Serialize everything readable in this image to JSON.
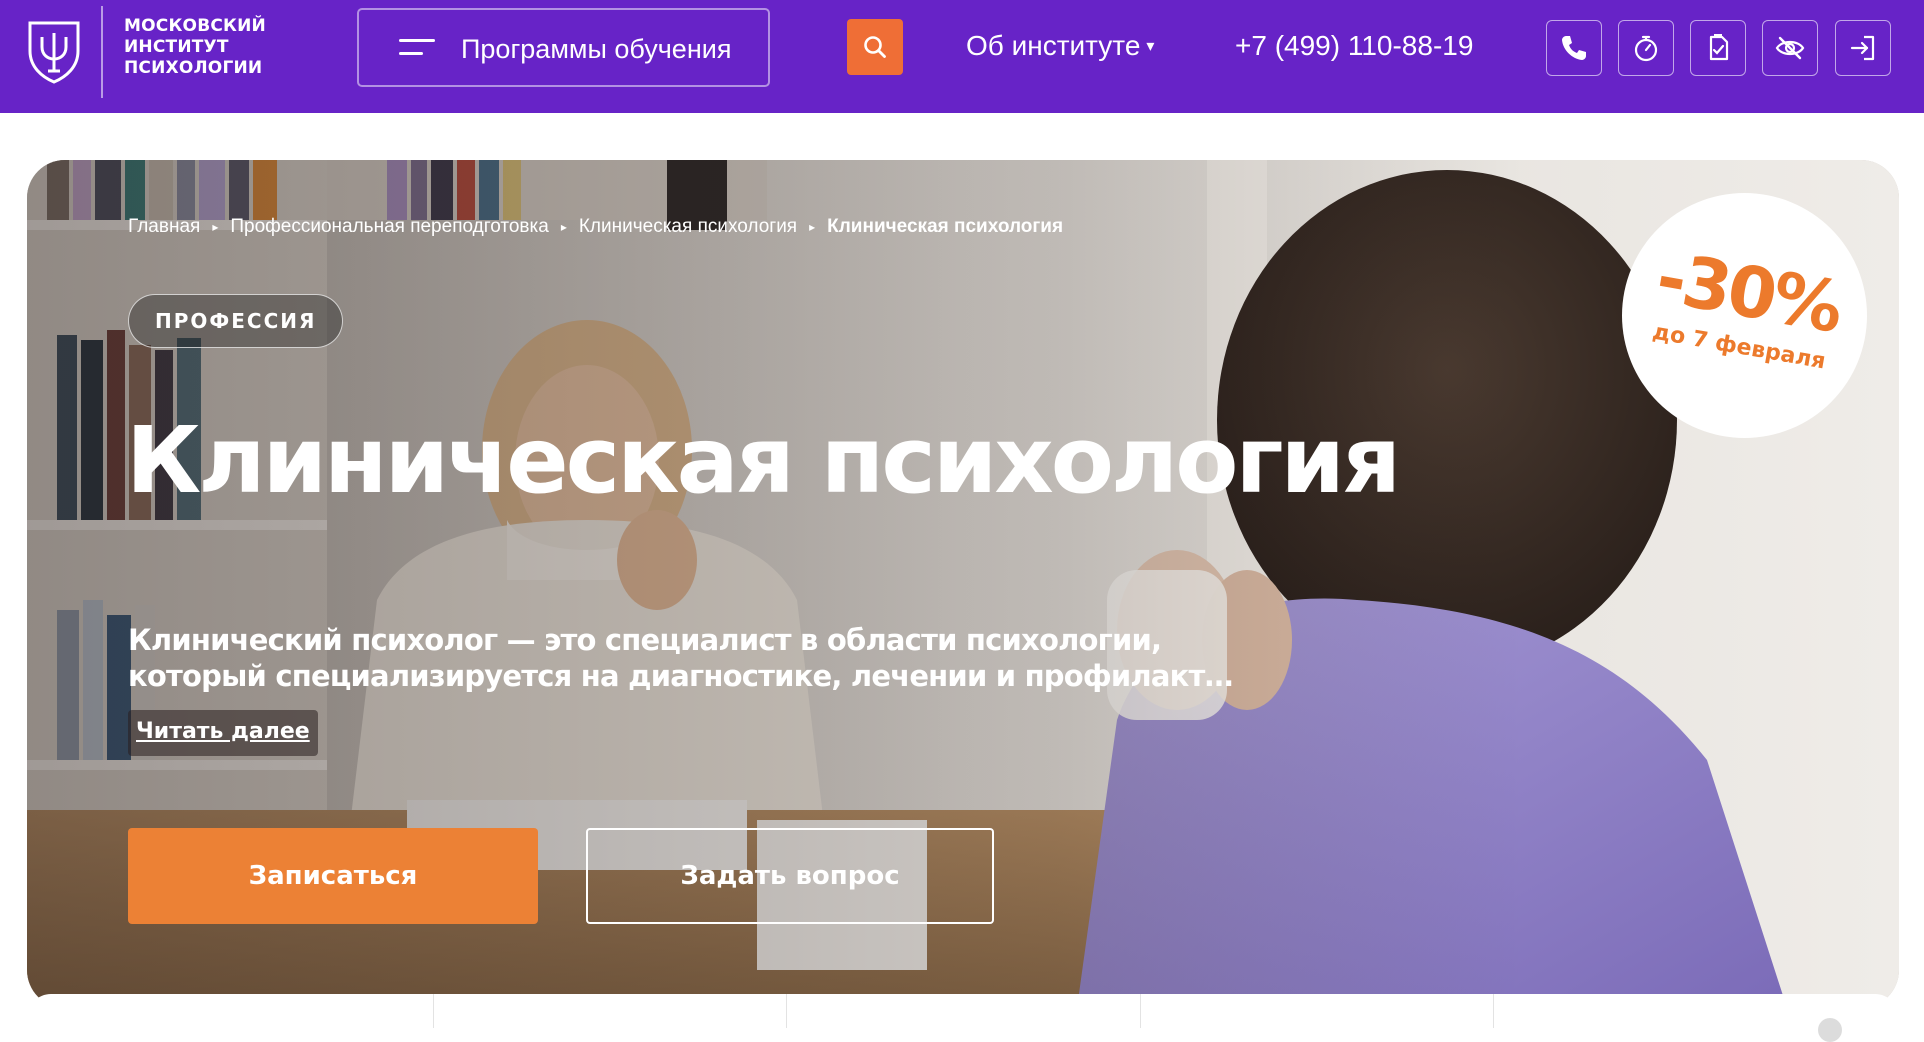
{
  "header": {
    "logo_text": "МОСКОВСКИЙ ИНСТИТУТ ПСИХОЛОГИИ",
    "logo_icon": "psi-shield-icon",
    "programs_label": "Программы обучения",
    "search_icon": "search-icon",
    "about_label": "Об институте",
    "about_caret": "▾",
    "phone": "+7 (499) 110-88-19",
    "icon_buttons": [
      "phone-icon",
      "timer-icon",
      "document-icon",
      "eye-off-icon",
      "login-icon"
    ],
    "background_color": "#6723c7",
    "search_color": "#ef6e36"
  },
  "breadcrumb": {
    "items": [
      "Главная",
      "Профессиональная переподготовка",
      "Клиническая психология"
    ],
    "current": "Клиническая психология",
    "separator": "▸"
  },
  "hero": {
    "tag": "ПРОФЕССИЯ",
    "title": "Клиническая психология",
    "description": "Клинический психолог — это специалист в области психологии, который специализируется на диагностике, лечении и профилакт…",
    "read_more": "Читать далее",
    "enroll_button": "Записаться",
    "ask_button": "Задать вопрос",
    "enroll_color": "#ec8135"
  },
  "discount": {
    "value": "-30%",
    "until": "до 7 февраля",
    "color": "#ec7a2c"
  }
}
